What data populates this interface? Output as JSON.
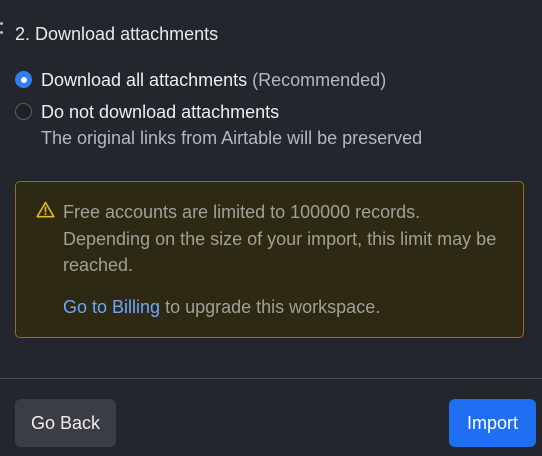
{
  "section": {
    "title": "2. Download attachments"
  },
  "options": [
    {
      "label": "Download all attachments",
      "suffix": "(Recommended)",
      "selected": true
    },
    {
      "label": "Do not download attachments",
      "description": "The original links from Airtable will be preserved",
      "selected": false
    }
  ],
  "warning": {
    "icon": "warning-triangle-icon",
    "message": "Free accounts are limited to 100000 records. Depending on the size of your import, this limit may be reached.",
    "link_label": "Go to Billing",
    "link_suffix": "to upgrade this workspace."
  },
  "footer": {
    "back_label": "Go Back",
    "import_label": "Import"
  },
  "colors": {
    "background": "#23262c",
    "accent": "#2f7cf6",
    "warning_border": "#8d7417",
    "warning_bg": "#2d2913",
    "link": "#6fa6ff"
  }
}
